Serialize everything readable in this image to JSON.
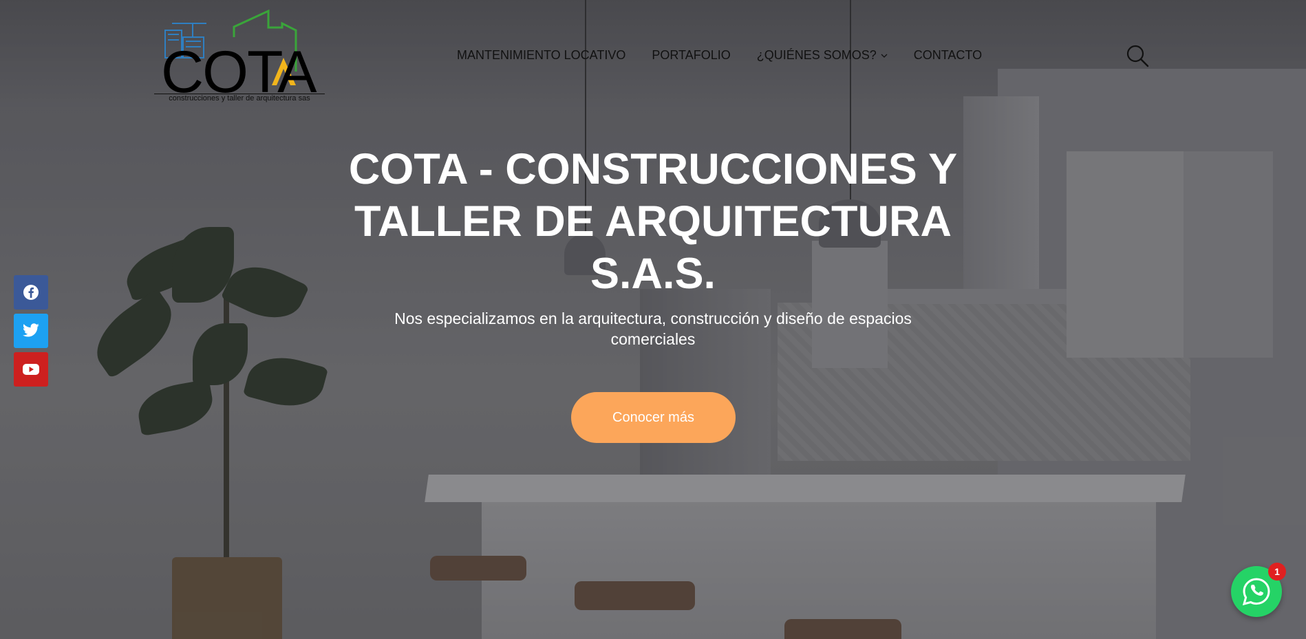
{
  "header": {
    "logo": {
      "wordmark": "COTA",
      "tagline": "construcciones y taller de arquitectura sas",
      "colors": {
        "blue": "#2f7fc1",
        "green": "#3aa53a",
        "yellow": "#f2b51c"
      }
    },
    "nav": [
      {
        "label": "MANTENIMIENTO LOCATIVO"
      },
      {
        "label": "PORTAFOLIO"
      },
      {
        "label": "¿QUIÉNES SOMOS?",
        "has_dropdown": true
      },
      {
        "label": "CONTACTO"
      }
    ],
    "search_icon": "search-icon"
  },
  "social": [
    {
      "name": "facebook",
      "icon": "facebook-icon",
      "color": "#3b5998"
    },
    {
      "name": "twitter",
      "icon": "twitter-icon",
      "color": "#1da1f2"
    },
    {
      "name": "youtube",
      "icon": "youtube-icon",
      "color": "#cd201f"
    }
  ],
  "hero": {
    "title": "COTA - CONSTRUCCIONES Y TALLER DE ARQUITECTURA S.A.S.",
    "subtitle": "Nos especializamos en la arquitectura, construcción y diseño de espacios comerciales",
    "cta_label": "Conocer más",
    "cta_color": "#fca65a"
  },
  "whatsapp": {
    "icon": "whatsapp-icon",
    "badge_count": "1",
    "color": "#25d366"
  }
}
